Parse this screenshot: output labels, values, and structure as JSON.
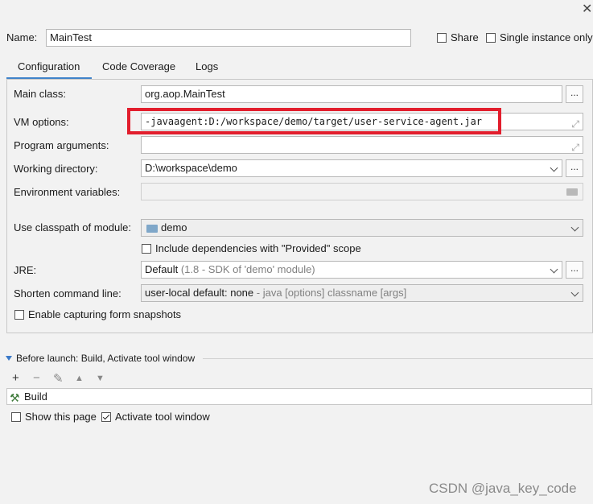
{
  "dialog": {
    "close_glyph": "✕"
  },
  "name": {
    "label": "Name:",
    "value": "MainTest"
  },
  "share": {
    "label": "Share",
    "checked": false
  },
  "single_instance": {
    "label": "Single instance only",
    "checked": false
  },
  "tabs": [
    {
      "label": "Configuration",
      "active": true
    },
    {
      "label": "Code Coverage",
      "active": false
    },
    {
      "label": "Logs",
      "active": false
    }
  ],
  "fields": {
    "main_class": {
      "label": "Main class:",
      "value": "org.aop.MainTest",
      "button": "..."
    },
    "vm_options": {
      "label": "VM options:",
      "value": "-javaagent:D:/workspace/demo/target/user-service-agent.jar"
    },
    "program_arguments": {
      "label": "Program arguments:",
      "value": ""
    },
    "working_directory": {
      "label": "Working directory:",
      "value": "D:\\workspace\\demo",
      "button": "..."
    },
    "environment_variables": {
      "label": "Environment variables:",
      "value": ""
    },
    "classpath_module": {
      "label": "Use classpath of module:",
      "value": "demo"
    },
    "include_provided": {
      "label": "Include dependencies with \"Provided\" scope",
      "checked": false
    },
    "jre": {
      "label": "JRE:",
      "value_main": "Default",
      "value_hint": "(1.8 - SDK of 'demo' module)",
      "button": "..."
    },
    "shorten_command_line": {
      "label": "Shorten command line:",
      "value_main": "user-local default: none",
      "value_hint": "- java [options] classname [args]"
    },
    "form_snapshots": {
      "label": "Enable capturing form snapshots",
      "checked": false
    }
  },
  "before_launch": {
    "title": "Before launch: Build, Activate tool window",
    "toolbar": [
      "+",
      "−",
      "✎",
      "▲",
      "▼"
    ],
    "items": [
      "Build"
    ]
  },
  "show_this_page": {
    "label": "Show this page",
    "checked": false
  },
  "activate_tool_window": {
    "label": "Activate tool window",
    "checked": true
  },
  "watermark": "CSDN @java_key_code",
  "colors": {
    "highlight": "#e21e2d",
    "accent": "#4083c9"
  }
}
